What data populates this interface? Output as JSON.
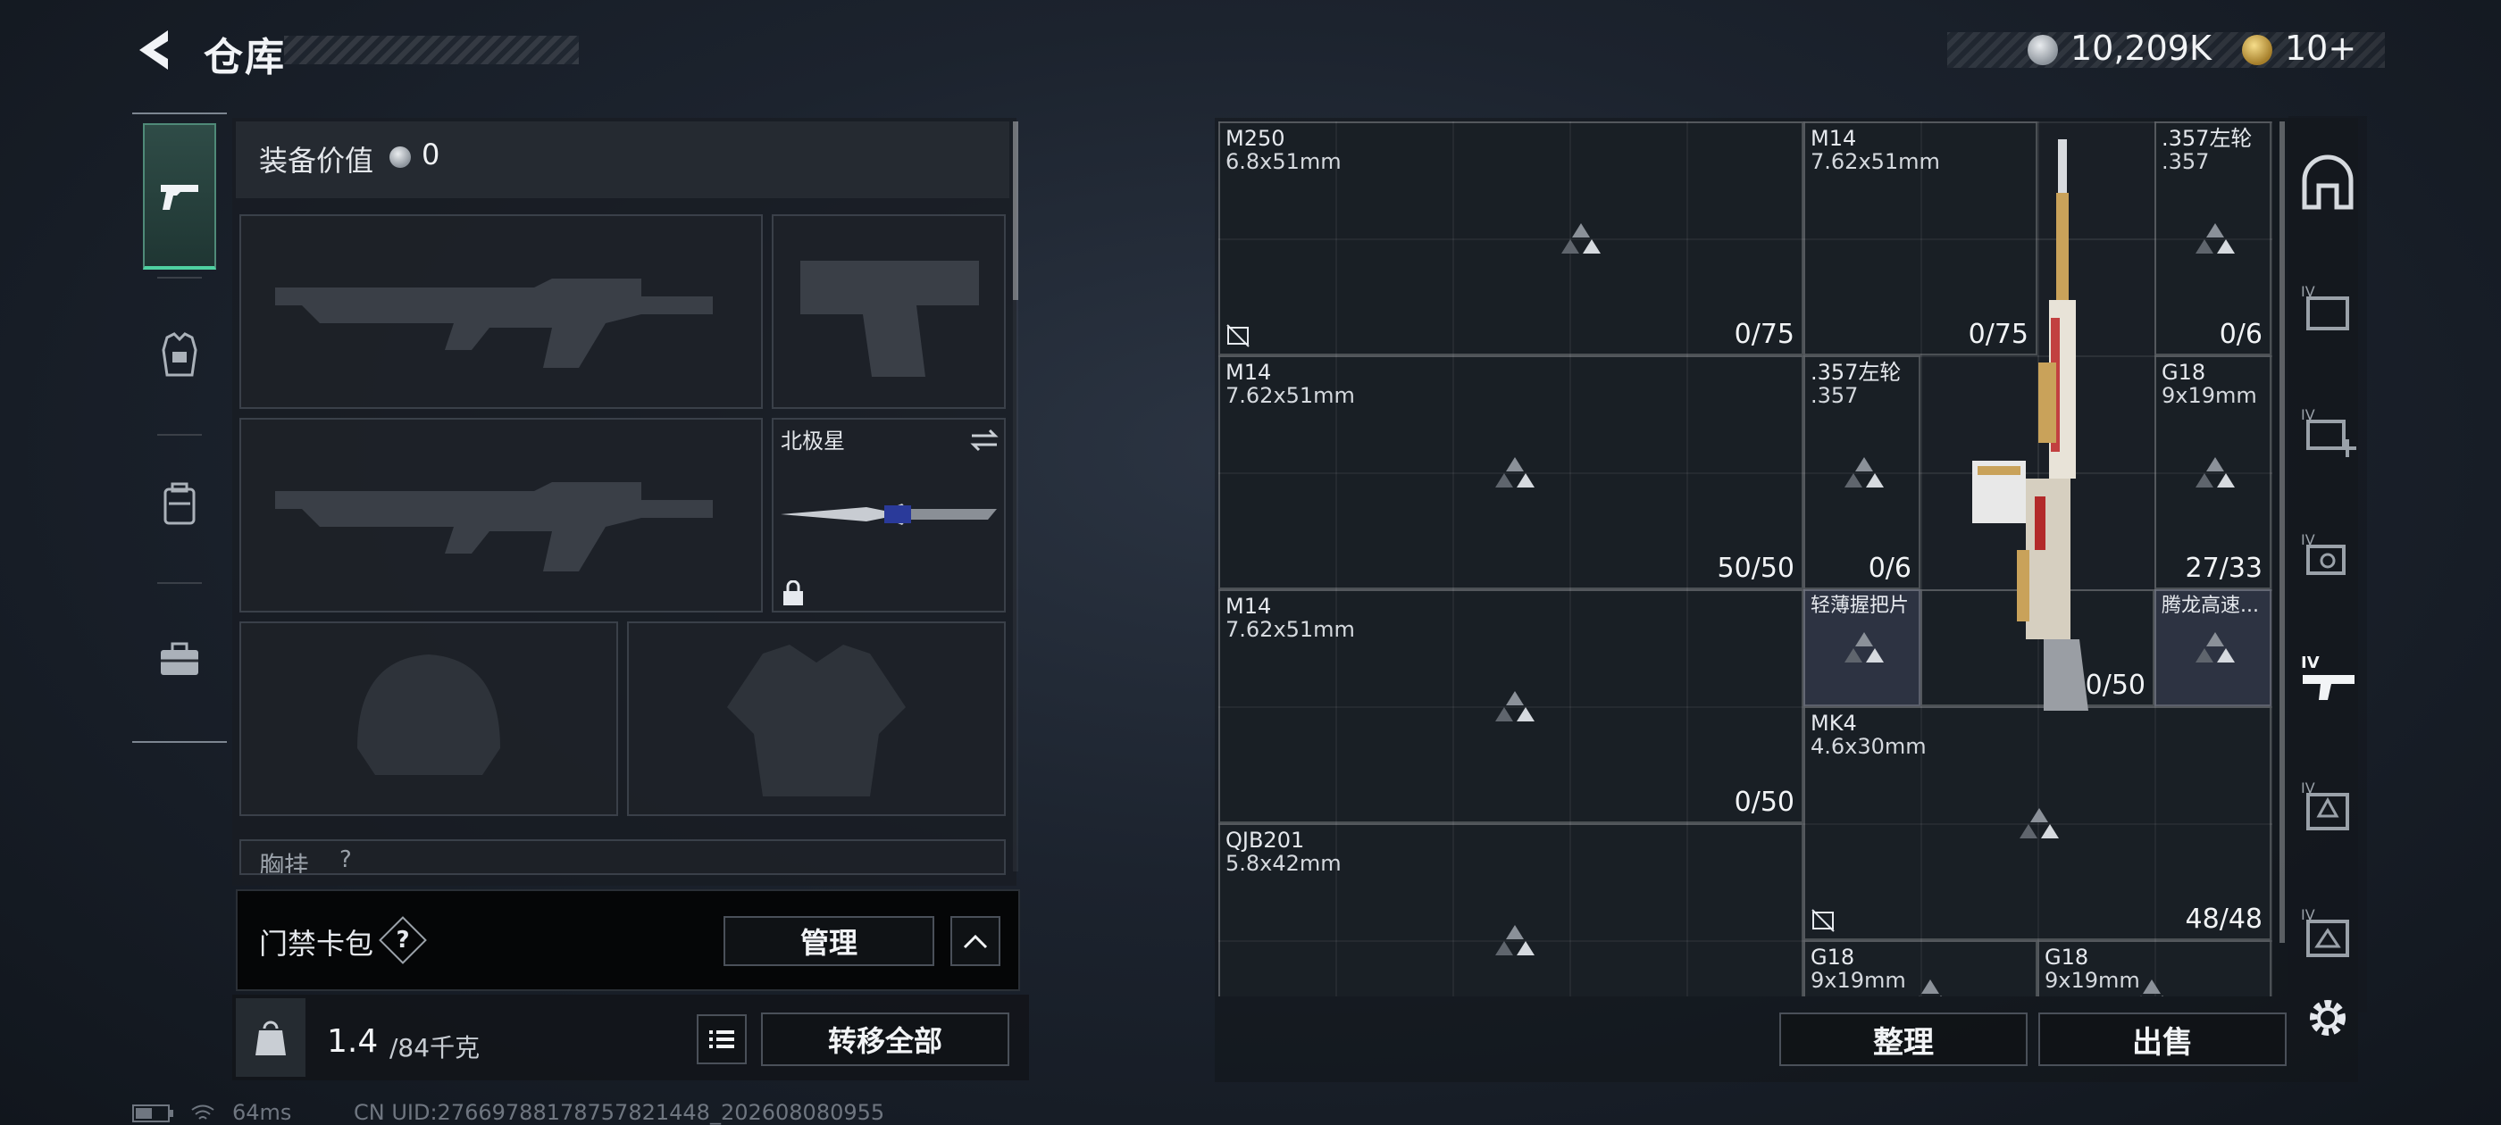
{
  "header": {
    "title": "仓库",
    "silver_amount": "10,209K",
    "gold_amount": "10+"
  },
  "equipment": {
    "value_label": "装备价值",
    "value": "0",
    "knife_name": "北极星",
    "chest_rig_label": "胸挂",
    "chest_rig_hint": "?"
  },
  "keycard": {
    "label": "门禁卡包",
    "help": "?",
    "manage_label": "管理"
  },
  "bottom_left": {
    "weight_current": "1.4",
    "weight_max": "/84千克",
    "transfer_all_label": "转移全部"
  },
  "status": {
    "ping": "64ms",
    "uid": "CN UID:27669788178757821448_202608080955"
  },
  "storage": {
    "items": [
      {
        "name": "M250",
        "cal": "6.8x51mm",
        "count": "0/75"
      },
      {
        "name": "M14",
        "cal": "7.62x51mm",
        "count": ""
      },
      {
        "name": ".357左轮",
        "cal": ".357",
        "count": "0/6"
      },
      {
        "name": "M14",
        "cal": "7.62x51mm",
        "count": "50/50"
      },
      {
        "name": ".357左轮",
        "cal": ".357",
        "count": "0/6"
      },
      {
        "name": "G18",
        "cal": "9x19mm",
        "count": "27/33"
      },
      {
        "name": "M14",
        "cal": "7.62x51mm",
        "count": "0/50"
      },
      {
        "name": "轻薄握把片",
        "cal": "",
        "count": ""
      },
      {
        "name": "腾龙高速...",
        "cal": "",
        "count": ""
      },
      {
        "name": "MK4",
        "cal": "4.6x30mm",
        "count": "0/50"
      },
      {
        "name": "QJB201",
        "cal": "5.8x42mm",
        "count": ""
      },
      {
        "name": "",
        "cal": "",
        "count": "48/48"
      },
      {
        "name": "G18",
        "cal": "9x19mm",
        "count": ""
      },
      {
        "name": "G18",
        "cal": "9x19mm",
        "count": ""
      }
    ],
    "sort_label": "整理",
    "sell_label": "出售"
  },
  "colors": {
    "accent_green": "#4fd1a1",
    "background": "#1c232e"
  }
}
